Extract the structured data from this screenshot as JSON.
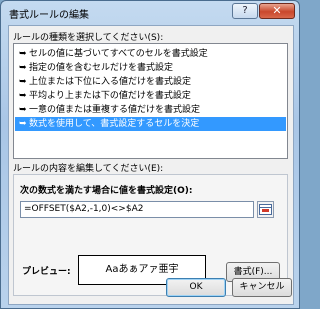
{
  "window": {
    "title": "書式ルールの編集",
    "help_label": "?",
    "close_label": "✕"
  },
  "rule_type": {
    "label": "ルールの種類を選択してください(S):",
    "items": [
      {
        "label": "セルの値に基づいてすべてのセルを書式設定",
        "selected": false
      },
      {
        "label": "指定の値を含むセルだけを書式設定",
        "selected": false
      },
      {
        "label": "上位または下位に入る値だけを書式設定",
        "selected": false
      },
      {
        "label": "平均より上または下の値だけを書式設定",
        "selected": false
      },
      {
        "label": "一意の値または重複する値だけを書式設定",
        "selected": false
      },
      {
        "label": "数式を使用して、書式設定するセルを決定",
        "selected": true
      }
    ]
  },
  "rule_content": {
    "label": "ルールの内容を編集してください(E):",
    "formula_label": "次の数式を満たす場合に値を書式設定(O):",
    "formula_value": "=OFFSET($A2,-1,0)<>$A2",
    "preview_label": "プレビュー:",
    "preview_text": "Aaあぁアァ亜宇",
    "format_button": "書式(F)..."
  },
  "footer": {
    "ok_label": "OK",
    "cancel_label": "キャンセル"
  },
  "colors": {
    "selection": "#3399ff",
    "title_gradient_top": "#c4daf0",
    "close_button": "#c9472c"
  }
}
